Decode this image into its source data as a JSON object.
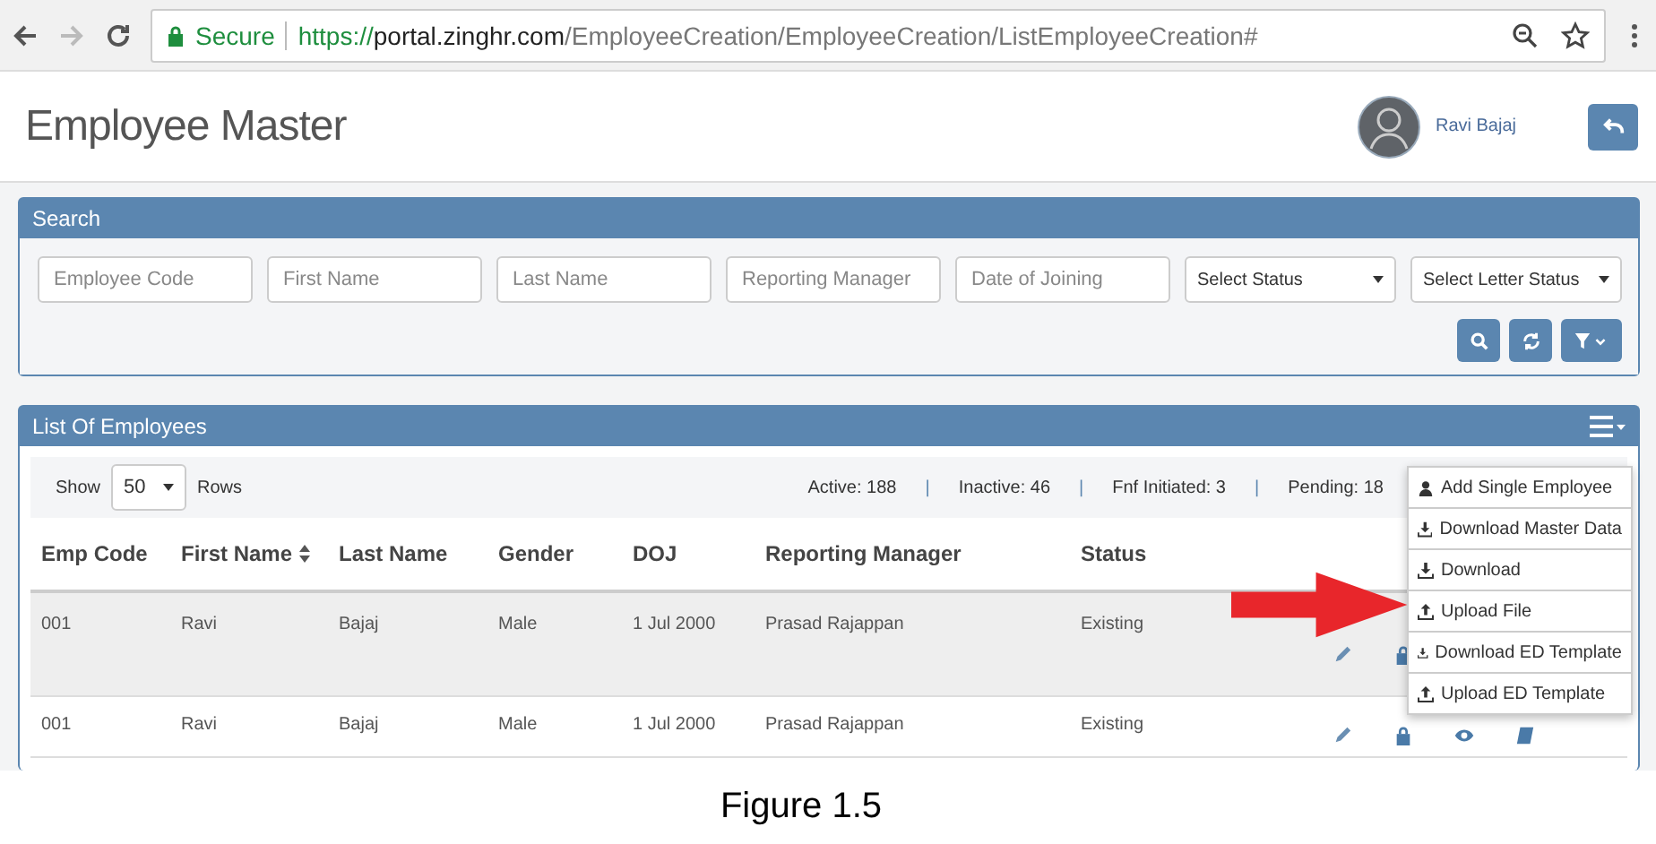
{
  "browser": {
    "secure_label": "Secure",
    "url_scheme": "https://",
    "url_host": "portal.zinghr.com",
    "url_path": "/EmployeeCreation/EmployeeCreation/ListEmployeeCreation#"
  },
  "header": {
    "title": "Employee Master",
    "user_name": "Ravi Bajaj"
  },
  "search_panel": {
    "title": "Search",
    "fields": [
      {
        "kind": "text",
        "placeholder": "Employee Code"
      },
      {
        "kind": "text",
        "placeholder": "First Name"
      },
      {
        "kind": "text",
        "placeholder": "Last Name"
      },
      {
        "kind": "text",
        "placeholder": "Reporting Manager"
      },
      {
        "kind": "text",
        "placeholder": "Date of Joining"
      },
      {
        "kind": "select",
        "value": "Select Status"
      },
      {
        "kind": "select",
        "value": "Select Letter Status"
      }
    ]
  },
  "list_panel": {
    "title": "List Of Employees",
    "show_label": "Show",
    "rows_select": "50",
    "rows_label": "Rows",
    "counts": [
      {
        "kind": "count",
        "text": "Active: 188"
      },
      {
        "kind": "separator",
        "text": "|"
      },
      {
        "kind": "count",
        "text": "Inactive: 46"
      },
      {
        "kind": "separator",
        "text": "|"
      },
      {
        "kind": "count",
        "text": "Fnf Initiated: 3"
      },
      {
        "kind": "separator",
        "text": "|"
      },
      {
        "kind": "count",
        "text": "Pending: 18"
      }
    ],
    "columns": [
      {
        "label": "Emp Code",
        "sortable": false
      },
      {
        "label": "First Name",
        "sortable": true
      },
      {
        "label": "Last Name",
        "sortable": false
      },
      {
        "label": "Gender",
        "sortable": false
      },
      {
        "label": "DOJ",
        "sortable": false
      },
      {
        "label": "Reporting Manager",
        "sortable": false
      },
      {
        "label": "Status",
        "sortable": false
      }
    ],
    "rows": [
      {
        "selected": true,
        "cells": [
          "001",
          "Ravi",
          "Bajaj",
          "Male",
          "1 Jul 2000",
          "Prasad Rajappan",
          "Existing"
        ],
        "actions": [
          {
            "kind": "edit"
          },
          {
            "kind": "lock"
          }
        ]
      },
      {
        "selected": false,
        "cells": [
          "001",
          "Ravi",
          "Bajaj",
          "Male",
          "1 Jul 2000",
          "Prasad Rajappan",
          "Existing"
        ],
        "actions": [
          {
            "kind": "edit"
          },
          {
            "kind": "lock"
          },
          {
            "kind": "view"
          },
          {
            "kind": "book"
          }
        ]
      }
    ]
  },
  "menu": {
    "items": [
      {
        "kind": "user",
        "label": "Add Single Employee"
      },
      {
        "kind": "download",
        "label": "Download Master Data"
      },
      {
        "kind": "download",
        "label": "Download"
      },
      {
        "kind": "upload",
        "label": "Upload File"
      },
      {
        "kind": "download",
        "label": "Download ED Template"
      },
      {
        "kind": "upload",
        "label": "Upload ED Template"
      }
    ]
  },
  "caption": "Figure 1.5"
}
